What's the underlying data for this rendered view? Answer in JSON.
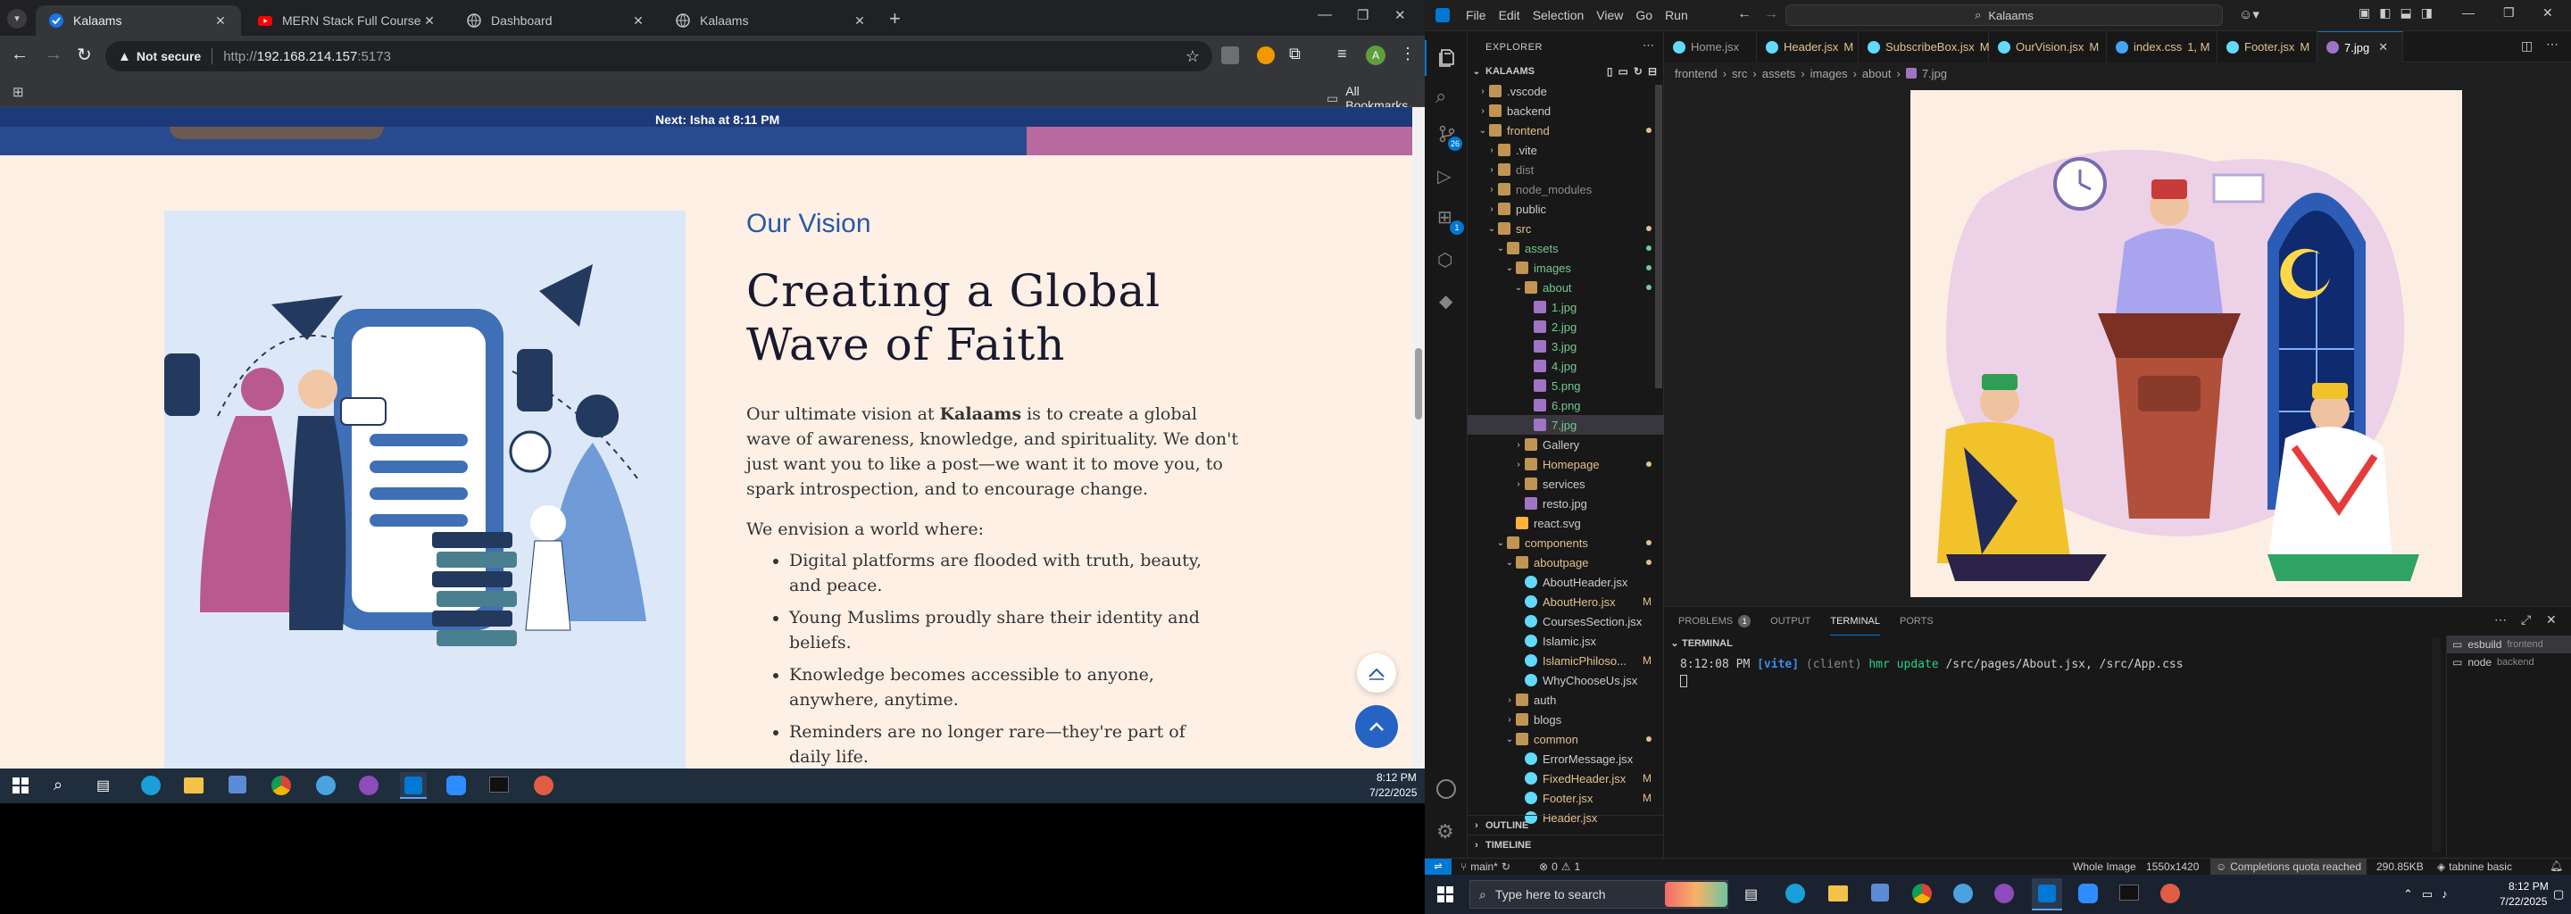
{
  "chrome": {
    "tabs": [
      {
        "title": "Kalaams",
        "active": true
      },
      {
        "title": "MERN Stack Full Course - ECom",
        "active": false
      },
      {
        "title": "Dashboard",
        "active": false
      },
      {
        "title": "Kalaams",
        "active": false
      }
    ],
    "omnibox": {
      "security": "Not secure",
      "url_prefix": "http://",
      "url_host": "192.168.214.157",
      "url_port": ":5173"
    },
    "bookmarks_label": "All Bookmarks",
    "profile_initial": "A"
  },
  "site": {
    "banner": "Next: Isha at 8:11 PM",
    "eyebrow": "Our Vision",
    "heading": "Creating a Global Wave of Faith",
    "intro_before": "Our ultimate vision at ",
    "intro_brand": "Kalaams",
    "intro_after": " is to create a global wave of awareness, knowledge, and spirituality. We don't just want you to like a post—we want it to move you, to spark introspection, and to encourage change.",
    "envision": "We envision a world where:",
    "bullets": [
      "Digital platforms are flooded with truth, beauty, and peace.",
      "Young Muslims proudly share their identity and beliefs.",
      "Knowledge becomes accessible to anyone, anywhere, anytime.",
      "Reminders are no longer rare—they're part of daily life."
    ]
  },
  "taskbar_left": {
    "time": "8:12 PM",
    "date": "7/22/2025"
  },
  "vscode": {
    "menu": [
      "File",
      "Edit",
      "Selection",
      "View",
      "Go",
      "Run"
    ],
    "search": "Kalaams",
    "explorer_title": "EXPLORER",
    "workspace": "KALAAMS",
    "tree": [
      {
        "label": ".vscode",
        "depth": 1,
        "kind": "folder",
        "open": false
      },
      {
        "label": "backend",
        "depth": 1,
        "kind": "folder",
        "open": false
      },
      {
        "label": "frontend",
        "depth": 1,
        "kind": "folder",
        "open": true,
        "color": "#e2c08d",
        "dot": true
      },
      {
        "label": ".vite",
        "depth": 2,
        "kind": "folder",
        "open": false
      },
      {
        "label": "dist",
        "depth": 2,
        "kind": "folder",
        "open": false,
        "color": "#8c8c8c"
      },
      {
        "label": "node_modules",
        "depth": 2,
        "kind": "folder",
        "open": false,
        "color": "#8c8c8c"
      },
      {
        "label": "public",
        "depth": 2,
        "kind": "folder",
        "open": false
      },
      {
        "label": "src",
        "depth": 2,
        "kind": "folder",
        "open": true,
        "color": "#e2c08d",
        "dot": true
      },
      {
        "label": "assets",
        "depth": 3,
        "kind": "folder",
        "open": true,
        "color": "#73c991",
        "dot": true
      },
      {
        "label": "images",
        "depth": 4,
        "kind": "folder",
        "open": true,
        "color": "#73c991",
        "dot": true
      },
      {
        "label": "about",
        "depth": 5,
        "kind": "folder",
        "open": true,
        "color": "#73c991",
        "dot": true
      },
      {
        "label": "1.jpg",
        "depth": 6,
        "kind": "img",
        "color": "#73c991"
      },
      {
        "label": "2.jpg",
        "depth": 6,
        "kind": "img",
        "color": "#73c991"
      },
      {
        "label": "3.jpg",
        "depth": 6,
        "kind": "img",
        "color": "#73c991"
      },
      {
        "label": "4.jpg",
        "depth": 6,
        "kind": "img",
        "color": "#73c991"
      },
      {
        "label": "5.png",
        "depth": 6,
        "kind": "img",
        "color": "#73c991"
      },
      {
        "label": "6.png",
        "depth": 6,
        "kind": "img",
        "color": "#73c991"
      },
      {
        "label": "7.jpg",
        "depth": 6,
        "kind": "img",
        "color": "#73c991",
        "selected": true
      },
      {
        "label": "Gallery",
        "depth": 5,
        "kind": "folder",
        "open": false
      },
      {
        "label": "Homepage",
        "depth": 5,
        "kind": "folder",
        "open": false,
        "color": "#e2c08d",
        "dot": true
      },
      {
        "label": "services",
        "depth": 5,
        "kind": "folder",
        "open": false
      },
      {
        "label": "resto.jpg",
        "depth": 5,
        "kind": "img"
      },
      {
        "label": "react.svg",
        "depth": 4,
        "kind": "svg"
      },
      {
        "label": "components",
        "depth": 3,
        "kind": "folder",
        "open": true,
        "color": "#e2c08d",
        "dot": true
      },
      {
        "label": "aboutpage",
        "depth": 4,
        "kind": "folder",
        "open": true,
        "color": "#e2c08d",
        "dot": true
      },
      {
        "label": "AboutHeader.jsx",
        "depth": 5,
        "kind": "jsx"
      },
      {
        "label": "AboutHero.jsx",
        "depth": 5,
        "kind": "jsx",
        "color": "#e2c08d",
        "mark": "M"
      },
      {
        "label": "CoursesSection.jsx",
        "depth": 5,
        "kind": "jsx"
      },
      {
        "label": "Islamic.jsx",
        "depth": 5,
        "kind": "jsx"
      },
      {
        "label": "IslamicPhiloso...",
        "depth": 5,
        "kind": "jsx",
        "color": "#e2c08d",
        "mark": "M"
      },
      {
        "label": "WhyChooseUs.jsx",
        "depth": 5,
        "kind": "jsx"
      },
      {
        "label": "auth",
        "depth": 4,
        "kind": "folder",
        "open": false
      },
      {
        "label": "blogs",
        "depth": 4,
        "kind": "folder",
        "open": false
      },
      {
        "label": "common",
        "depth": 4,
        "kind": "folder",
        "open": true,
        "color": "#e2c08d",
        "dot": true
      },
      {
        "label": "ErrorMessage.jsx",
        "depth": 5,
        "kind": "jsx"
      },
      {
        "label": "FixedHeader.jsx",
        "depth": 5,
        "kind": "jsx",
        "color": "#e2c08d",
        "mark": "M"
      },
      {
        "label": "Footer.jsx",
        "depth": 5,
        "kind": "jsx",
        "color": "#e2c08d",
        "mark": "M"
      },
      {
        "label": "Header.jsx",
        "depth": 5,
        "kind": "jsx",
        "color": "#e2c08d"
      }
    ],
    "outline": "OUTLINE",
    "timeline": "TIMELINE",
    "editor_tabs": [
      {
        "label": "Home.jsx",
        "mark": "",
        "color": "#9d9d9d"
      },
      {
        "label": "Header.jsx",
        "mark": "M",
        "color": "#e2c08d"
      },
      {
        "label": "SubscribeBox.jsx",
        "mark": "M",
        "color": "#e2c08d"
      },
      {
        "label": "OurVision.jsx",
        "mark": "M",
        "color": "#e2c08d"
      },
      {
        "label": "index.css",
        "mark": "1, M",
        "color": "#e2c08d"
      },
      {
        "label": "Footer.jsx",
        "mark": "M",
        "color": "#e2c08d"
      },
      {
        "label": "7.jpg",
        "mark": "",
        "color": "#73c991",
        "active": true
      }
    ],
    "breadcrumb": [
      "frontend",
      "src",
      "assets",
      "images",
      "about",
      "7.jpg"
    ],
    "panel_tabs": [
      {
        "label": "PROBLEMS",
        "badge": "1"
      },
      {
        "label": "OUTPUT",
        "badge": ""
      },
      {
        "label": "TERMINAL",
        "badge": "",
        "active": true
      },
      {
        "label": "PORTS",
        "badge": ""
      }
    ],
    "terminal_title": "TERMINAL",
    "terminal_line": {
      "time": "8:12:08 PM",
      "tag": "[vite]",
      "scope": "(client)",
      "msg": "hmr update",
      "files": "/src/pages/About.jsx, /src/App.css"
    },
    "terminal_instances": [
      {
        "name": "esbuild",
        "folder": "frontend"
      },
      {
        "name": "node",
        "folder": "backend"
      }
    ],
    "status": {
      "branch": "main*",
      "errors": "0",
      "warnings": "1",
      "image_mode": "Whole Image",
      "dimensions": "1550x1420",
      "quota": "Completions quota reached",
      "filesize": "290.85KB",
      "tabnine": "tabnine basic"
    },
    "badges": {
      "scm": "26",
      "ext": "1"
    }
  },
  "taskbar_right": {
    "search_placeholder": "Type here to search",
    "time": "8:12 PM",
    "date": "7/22/2025"
  },
  "colors": {
    "vision_blue": "#2859a8",
    "page_bg": "#fff0e6",
    "banner": "#2a4a8f",
    "vscode_accent": "#0078d4"
  }
}
